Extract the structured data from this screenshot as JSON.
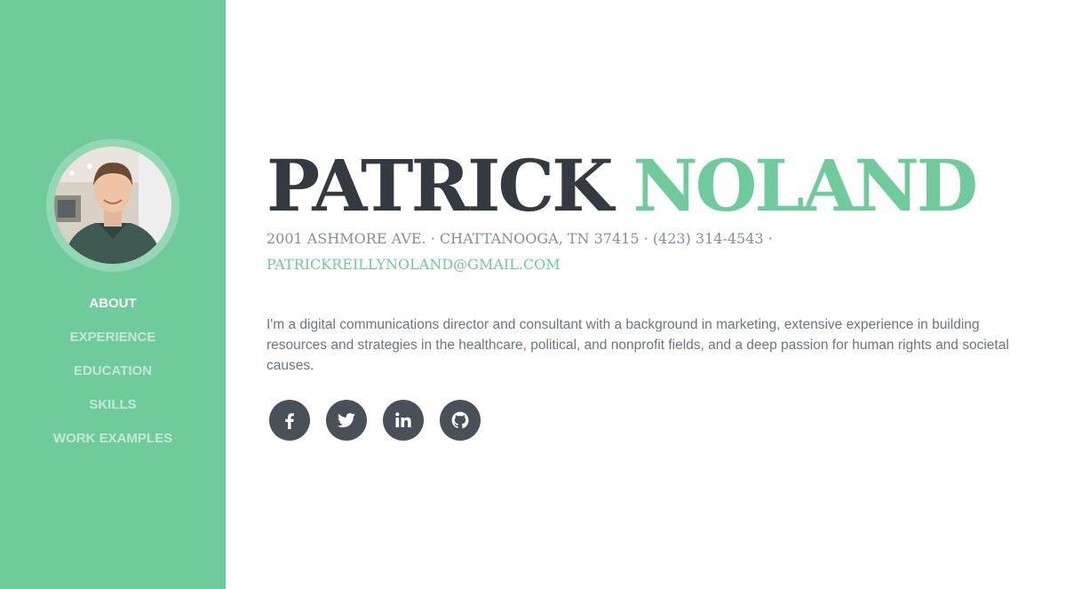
{
  "profile": {
    "first_name": "PATRICK",
    "last_name": "NOLAND",
    "address": "2001 ASHMORE AVE. · CHATTANOOGA, TN 37415 · (423) 314-4543 ·",
    "email": "PATRICKREILLYNOLAND@GMAIL.COM",
    "bio": "I'm a digital communications director and consultant with a background in marketing, extensive experience in building resources and strategies in the healthcare, political, and nonprofit fields, and a deep passion for human rights and societal causes."
  },
  "nav": {
    "items": [
      {
        "label": "ABOUT"
      },
      {
        "label": "EXPERIENCE"
      },
      {
        "label": "EDUCATION"
      },
      {
        "label": "SKILLS"
      },
      {
        "label": "WORK EXAMPLES"
      }
    ],
    "active": "ABOUT"
  },
  "social": [
    "facebook-icon",
    "twitter-icon",
    "linkedin-icon",
    "github-icon"
  ],
  "colors": {
    "accent": "#6fca9c",
    "dark": "#343a40",
    "muted": "#868e96",
    "icon_bg": "#495057"
  }
}
